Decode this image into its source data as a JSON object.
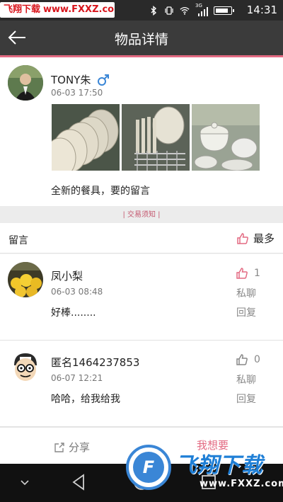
{
  "status_bar": {
    "watermark_site_name": "飞翔下载",
    "watermark_url": "www.FXXZ.com",
    "network_label": "3G",
    "time": "14:31",
    "icons": [
      "bluetooth-icon",
      "vibrate-icon",
      "wifi-icon",
      "signal-icon",
      "battery-icon"
    ]
  },
  "header": {
    "back_icon": "arrow-left-icon",
    "title": "物品详情"
  },
  "post": {
    "username": "TONY朱",
    "gender_icon": "male-icon",
    "time": "06-03 17:50",
    "photos": [
      "plates-photo",
      "dish-rack-photo",
      "tureen-photo"
    ],
    "description": "全新的餐具，要的留言"
  },
  "notice": "| 交易须知 |",
  "comments_header": {
    "label": "留言",
    "sort_label": "最多",
    "sort_icon": "thumbs-up-icon"
  },
  "comments": [
    {
      "name": "凤小梨",
      "time": "06-03 08:48",
      "text": "好棒........",
      "likes": "1",
      "liked": true,
      "private_chat": "私聊",
      "reply": "回复"
    },
    {
      "name": "匿名1464237853",
      "time": "06-07 12:21",
      "text": "哈哈，给我给我",
      "likes": "0",
      "liked": false,
      "private_chat": "私聊",
      "reply": "回复"
    }
  ],
  "bottom_bar": {
    "share_label": "分享",
    "want_label": "我想要"
  },
  "watermark": {
    "logo_text": "飞翔下载",
    "url": "www.FXXZ.com"
  },
  "nav_bar": {
    "buttons": [
      "hide-keyboard-icon",
      "back-triangle-icon",
      "home-circle-icon",
      "recents-square-icon"
    ]
  },
  "colors": {
    "accent": "#e36a82",
    "header_bg": "#3b3b3b",
    "status_bg": "#2a2a2a",
    "watermark_blue": "#1f7fd6"
  }
}
